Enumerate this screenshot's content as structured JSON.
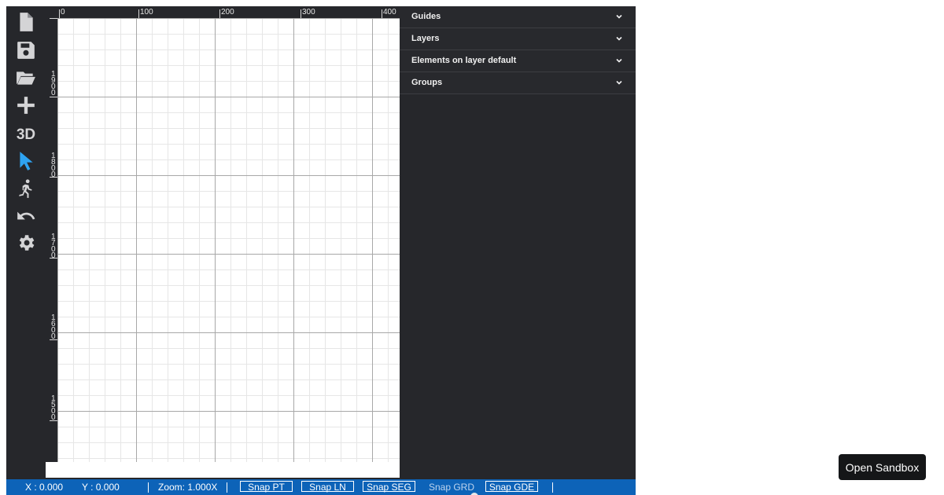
{
  "toolbar": {
    "items": [
      {
        "icon": "new-file-icon"
      },
      {
        "icon": "save-icon"
      },
      {
        "icon": "open-folder-icon"
      },
      {
        "icon": "add-icon"
      },
      {
        "label": "3D"
      },
      {
        "icon": "pointer-icon"
      },
      {
        "icon": "walk-icon"
      },
      {
        "icon": "undo-icon"
      },
      {
        "icon": "settings-icon"
      }
    ],
    "active_color": "#2ea3f2",
    "icon_color": "#d4d4d6"
  },
  "rulers": {
    "top_labels": [
      "0",
      "100",
      "200",
      "300",
      "400"
    ],
    "left_labels": [
      "1900",
      "1800",
      "1700",
      "1600",
      "1500"
    ]
  },
  "panels": {
    "guides": "Guides",
    "layers": "Layers",
    "elements": "Elements on layer default",
    "groups": "Groups"
  },
  "status": {
    "x": "X : 0.000",
    "y": "Y : 0.000",
    "zoom": "Zoom: 1.000X",
    "snap_pt": "Snap PT",
    "snap_ln": "Snap LN",
    "snap_seg": "Snap SEG",
    "snap_grd": "Snap GRD",
    "snap_gde": "Snap GDE",
    "bar_color": "#0d63b8"
  },
  "sandbox_label": "Open Sandbox"
}
